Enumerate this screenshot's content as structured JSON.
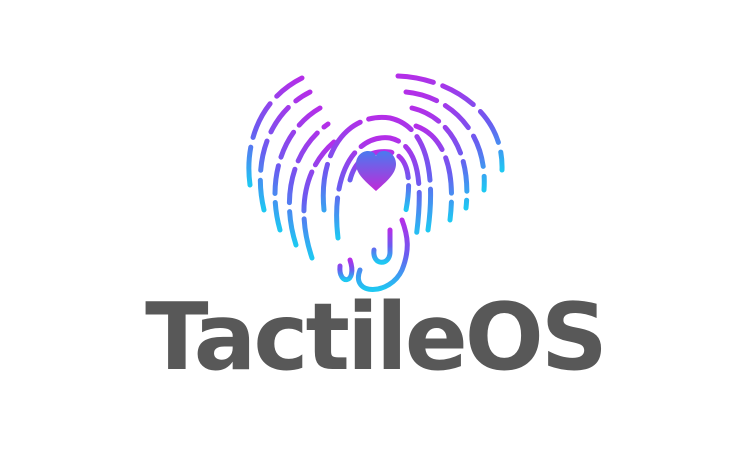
{
  "brand": {
    "name": "TactileOS",
    "wordmark_color": "#585858"
  },
  "emblem": {
    "icon": "fingerprint-heart-icon",
    "inner_icon": "heart-icon",
    "gradient": {
      "top": "#b42ee8",
      "mid": "#6a5cf0",
      "bottom": "#1ec8f2"
    }
  }
}
